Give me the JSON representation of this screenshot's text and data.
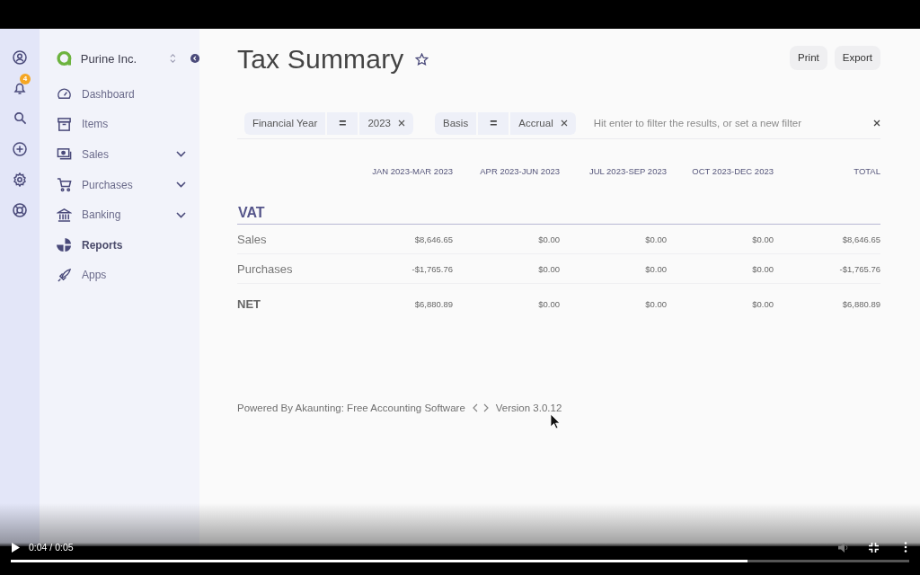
{
  "company": {
    "name": "Purine Inc."
  },
  "notifications": {
    "count": "4"
  },
  "menu": [
    {
      "label": "Dashboard",
      "expandable": false,
      "selected": false
    },
    {
      "label": "Items",
      "expandable": false,
      "selected": false
    },
    {
      "label": "Sales",
      "expandable": true,
      "selected": false
    },
    {
      "label": "Purchases",
      "expandable": true,
      "selected": false
    },
    {
      "label": "Banking",
      "expandable": true,
      "selected": false
    },
    {
      "label": "Reports",
      "expandable": false,
      "selected": true
    },
    {
      "label": "Apps",
      "expandable": false,
      "selected": false
    }
  ],
  "page": {
    "title": "Tax Summary",
    "favorite": false
  },
  "actions": [
    "Print",
    "Export"
  ],
  "filters": [
    {
      "field": "Financial Year",
      "operator": "=",
      "value": "2023"
    },
    {
      "field": "Basis",
      "operator": "=",
      "value": "Accrual"
    }
  ],
  "filter_search": {
    "placeholder": "Hit enter to filter the results, or set a new filter"
  },
  "table": {
    "columns": [
      "JAN 2023-MAR 2023",
      "APR 2023-JUN 2023",
      "JUL 2023-SEP 2023",
      "OCT 2023-DEC 2023",
      "TOTAL"
    ],
    "sections": [
      {
        "title": "VAT",
        "rows": [
          {
            "label": "Sales",
            "values": [
              "$8,646.65",
              "$0.00",
              "$0.00",
              "$0.00",
              "$8,646.65"
            ]
          },
          {
            "label": "Purchases",
            "values": [
              "-$1,765.76",
              "$0.00",
              "$0.00",
              "$0.00",
              "-$1,765.76"
            ]
          }
        ]
      }
    ],
    "total": {
      "label": "NET",
      "values": [
        "$6,880.89",
        "$0.00",
        "$0.00",
        "$0.00",
        "$6,880.89"
      ]
    }
  },
  "footer": {
    "text": "Powered By Akaunting: Free Accounting Software",
    "version": "Version 3.0.12"
  },
  "video": {
    "playing": false,
    "time": "0:04 / 0:05",
    "level": 0.82
  }
}
